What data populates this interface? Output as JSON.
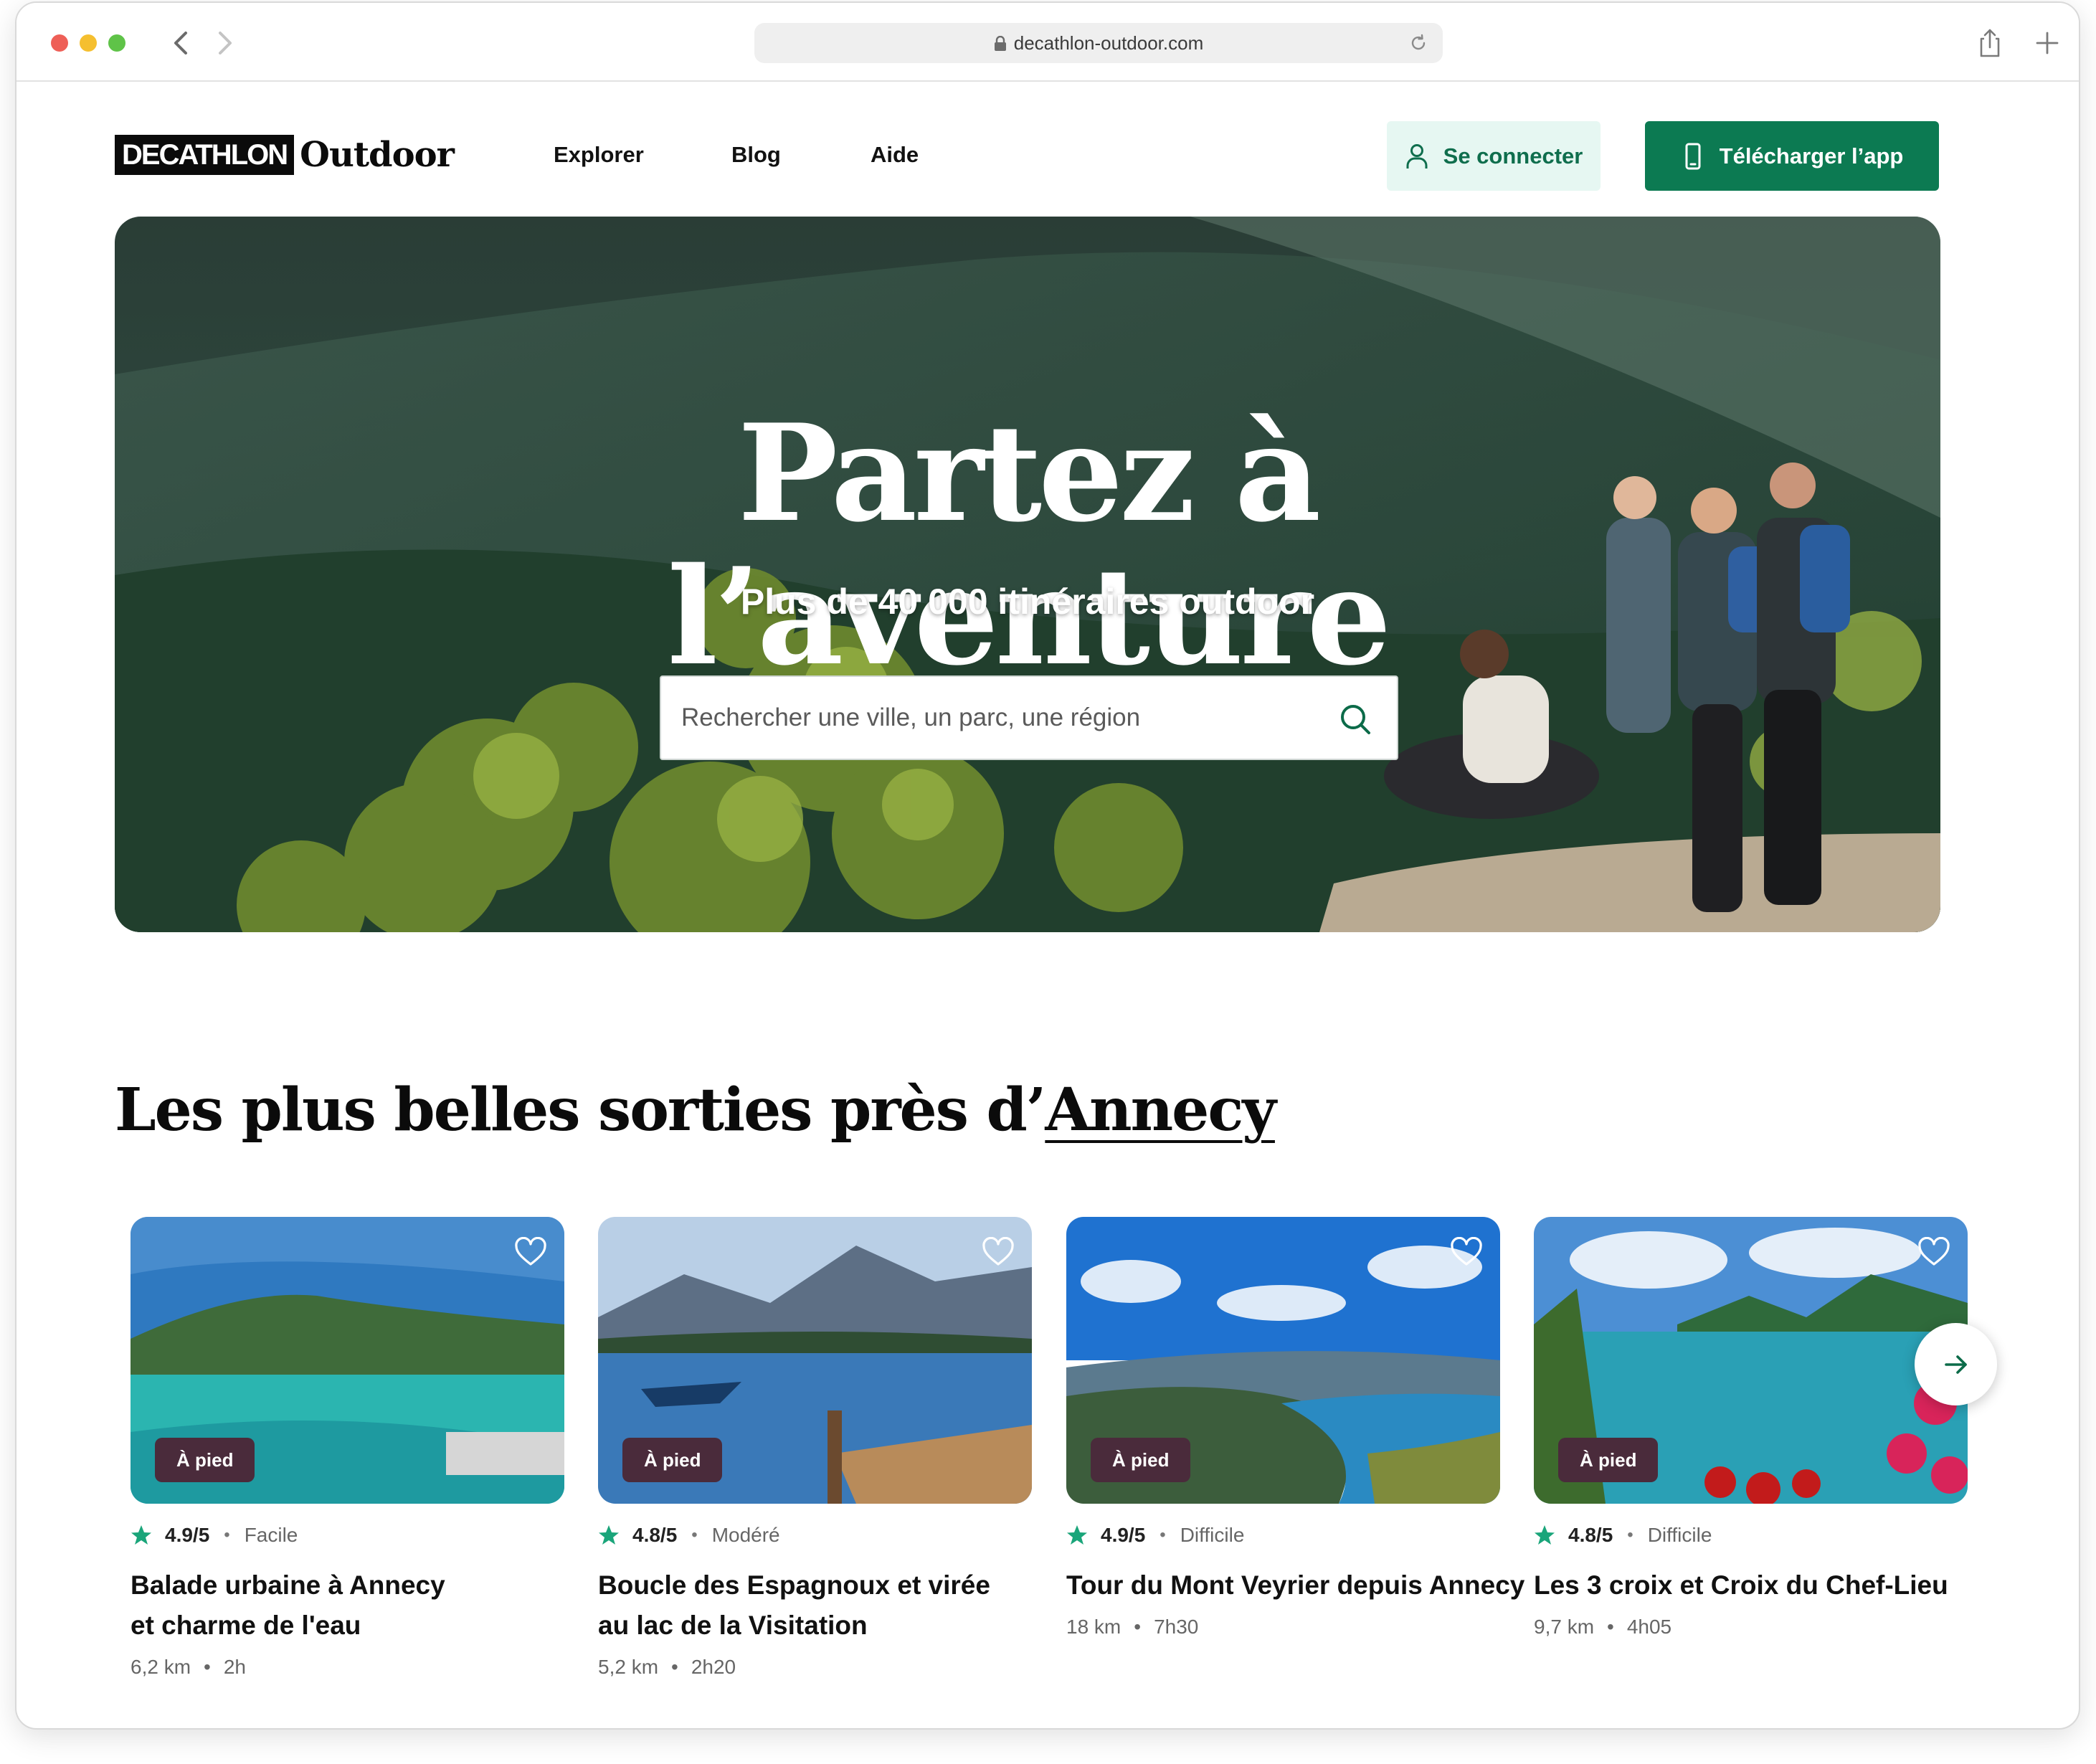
{
  "browser": {
    "url": "decathlon-outdoor.com",
    "icons": [
      "back-icon",
      "forward-icon",
      "lock-icon",
      "reload-icon",
      "share-icon",
      "new-tab-icon"
    ]
  },
  "header": {
    "logo_box": "DECATHLON",
    "logo_word": "Outdoor",
    "nav": [
      {
        "label": "Explorer"
      },
      {
        "label": "Blog"
      },
      {
        "label": "Aide"
      }
    ],
    "login_label": "Se connecter",
    "app_label": "Télécharger l’app"
  },
  "hero": {
    "title": "Partez à l’aventure",
    "subtitle": "Plus de 40 000 itinéraires outdoor",
    "search_placeholder": "Rechercher une ville, un parc, une région"
  },
  "section": {
    "title_prefix": "Les plus belles sorties près d’",
    "city": "Annecy"
  },
  "cards": [
    {
      "tag": "À pied",
      "rating": "4.9/5",
      "difficulty": "Facile",
      "title_line1": "Balade urbaine à Annecy",
      "title_line2": "et charme de l'eau",
      "distance": "6,2 km",
      "duration": "2h"
    },
    {
      "tag": "À pied",
      "rating": "4.8/5",
      "difficulty": "Modéré",
      "title_line1": "Boucle des Espagnoux et virée",
      "title_line2": "au lac de la Visitation",
      "distance": "5,2 km",
      "duration": "2h20"
    },
    {
      "tag": "À pied",
      "rating": "4.9/5",
      "difficulty": "Difficile",
      "title_line1": "Tour du Mont Veyrier depuis Annecy",
      "title_line2": "",
      "distance": "18 km",
      "duration": "7h30"
    },
    {
      "tag": "À pied",
      "rating": "4.8/5",
      "difficulty": "Difficile",
      "title_line1": "Les 3 croix et Croix du Chef-Lieu",
      "title_line2": "",
      "distance": "9,7 km",
      "duration": "4h05"
    }
  ],
  "colors": {
    "brand_green": "#0c7a52",
    "login_bg": "#e6f7f2",
    "tag_bg": "#4a2b3b",
    "star": "#1aa57a"
  }
}
